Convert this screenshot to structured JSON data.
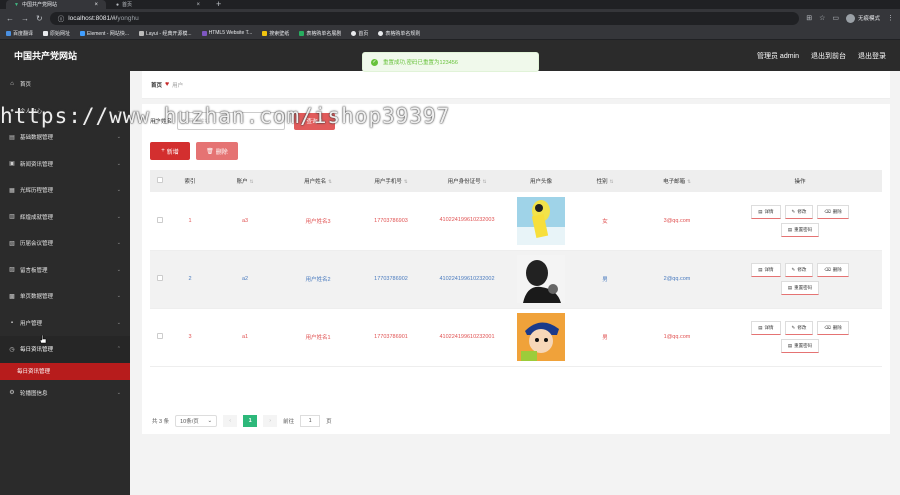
{
  "browser": {
    "tabs": [
      {
        "title": "中国共产党网站",
        "active": true
      },
      {
        "title": "首页",
        "active": false
      }
    ],
    "url_host": "localhost:8081/#/",
    "url_path": "yonghu",
    "profile": "无痕模式",
    "bookmarks": [
      "百度翻译",
      "原始网址",
      "Element - 网站快...",
      "Layui - 经典开源模...",
      "HTML5 Website T...",
      "搜索壁纸",
      "表格购单名展剧",
      "首页",
      "表格购单名规则"
    ]
  },
  "app": {
    "brand": "中国共产党网站",
    "admin": "管理员 admin",
    "backend": "退出到前台",
    "logout": "退出登录"
  },
  "toast": "重置成功,密码已重置为123456",
  "sidebar": {
    "items": [
      {
        "label": "首页",
        "icon": "home-icon"
      },
      {
        "label": "个人中心",
        "icon": "user-icon"
      },
      {
        "label": "基础数据管理",
        "icon": "grid-icon"
      },
      {
        "label": "新闻资讯管理",
        "icon": "news-icon"
      },
      {
        "label": "光辉历程管理",
        "icon": "history-icon"
      },
      {
        "label": "辉煌成就管理",
        "icon": "trophy-icon"
      },
      {
        "label": "历届会议管理",
        "icon": "meeting-icon"
      },
      {
        "label": "留言板管理",
        "icon": "message-icon"
      },
      {
        "label": "单页数据管理",
        "icon": "page-icon"
      },
      {
        "label": "用户管理",
        "icon": "users-icon"
      },
      {
        "label": "每日资讯管理",
        "icon": "calendar-icon"
      },
      {
        "label": "轮播图信息",
        "icon": "image-icon"
      }
    ],
    "sub_active": "每日资讯管理"
  },
  "breadcrumb": {
    "home": "首页",
    "current": "用户"
  },
  "search": {
    "label": "用户姓名",
    "placeholder": "用户姓名",
    "button": "查询"
  },
  "actions": {
    "add": "新增",
    "delete": "删除"
  },
  "table": {
    "headers": [
      "索引",
      "账户",
      "用户姓名",
      "用户手机号",
      "用户身份证号",
      "用户头像",
      "性别",
      "电子邮箱",
      "操作"
    ],
    "rows": [
      {
        "index": "1",
        "account": "a3",
        "name": "用户姓名3",
        "phone": "17703786903",
        "idcard": "410224199610232003",
        "gender": "女",
        "email": "3@qq.com"
      },
      {
        "index": "2",
        "account": "a2",
        "name": "用户姓名2",
        "phone": "17703786902",
        "idcard": "410224199610232002",
        "gender": "男",
        "email": "2@qq.com"
      },
      {
        "index": "3",
        "account": "a1",
        "name": "用户姓名1",
        "phone": "17703786901",
        "idcard": "410224199610232001",
        "gender": "男",
        "email": "1@qq.com"
      }
    ],
    "ops": {
      "detail": "详情",
      "edit": "修改",
      "delete": "删除",
      "reset": "重置密码"
    }
  },
  "pager": {
    "total": "共 3 条",
    "size": "10条/页",
    "page": "1",
    "goto": "前往",
    "goto_val": "1",
    "unit": "页"
  },
  "watermark": "https://www.huzhan.com/ishop39397"
}
